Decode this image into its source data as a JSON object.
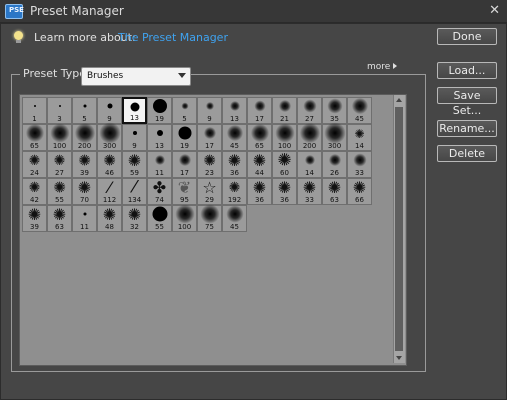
{
  "window": {
    "title": "Preset Manager",
    "close_glyph": "✕",
    "app_icon_text": "PSE"
  },
  "learn": {
    "label": "Learn more about:",
    "link": "The Preset Manager"
  },
  "buttons": {
    "done": "Done",
    "load": "Load...",
    "save_set": "Save Set...",
    "rename": "Rename...",
    "delete": "Delete"
  },
  "preset_type": {
    "label": "Preset Type:",
    "value": "Brushes"
  },
  "more": "more",
  "colors": {
    "background": "#464646",
    "link": "#3fa3f0",
    "grid": "#8f8f8f",
    "cell": "#9b9b9b"
  },
  "brushes": [
    {
      "size": "1",
      "kind": "hard",
      "d": 2
    },
    {
      "size": "3",
      "kind": "hard",
      "d": 2
    },
    {
      "size": "5",
      "kind": "hard",
      "d": 3
    },
    {
      "size": "9",
      "kind": "hard",
      "d": 5
    },
    {
      "size": "13",
      "kind": "hard",
      "d": 9,
      "selected": true
    },
    {
      "size": "19",
      "kind": "hard",
      "d": 14
    },
    {
      "size": "5",
      "kind": "soft",
      "d": 3
    },
    {
      "size": "9",
      "kind": "soft",
      "d": 4
    },
    {
      "size": "13",
      "kind": "soft",
      "d": 6
    },
    {
      "size": "17",
      "kind": "soft",
      "d": 7
    },
    {
      "size": "21",
      "kind": "soft",
      "d": 8
    },
    {
      "size": "27",
      "kind": "soft",
      "d": 9
    },
    {
      "size": "35",
      "kind": "soft",
      "d": 11
    },
    {
      "size": "45",
      "kind": "soft",
      "d": 12
    },
    {
      "size": "65",
      "kind": "soft",
      "d": 14
    },
    {
      "size": "100",
      "kind": "soft",
      "d": 15
    },
    {
      "size": "200",
      "kind": "soft",
      "d": 16
    },
    {
      "size": "300",
      "kind": "soft",
      "d": 17
    },
    {
      "size": "9",
      "kind": "hard",
      "d": 4
    },
    {
      "size": "13",
      "kind": "hard",
      "d": 6
    },
    {
      "size": "19",
      "kind": "hard",
      "d": 13
    },
    {
      "size": "17",
      "kind": "soft",
      "d": 8
    },
    {
      "size": "45",
      "kind": "soft",
      "d": 12
    },
    {
      "size": "65",
      "kind": "soft",
      "d": 14
    },
    {
      "size": "100",
      "kind": "soft",
      "d": 15
    },
    {
      "size": "200",
      "kind": "soft",
      "d": 16
    },
    {
      "size": "300",
      "kind": "soft",
      "d": 17
    },
    {
      "size": "14",
      "kind": "tex",
      "d": 10
    },
    {
      "size": "24",
      "kind": "tex",
      "d": 12
    },
    {
      "size": "27",
      "kind": "tex",
      "d": 12
    },
    {
      "size": "39",
      "kind": "tex",
      "d": 13
    },
    {
      "size": "46",
      "kind": "tex",
      "d": 13
    },
    {
      "size": "59",
      "kind": "tex",
      "d": 14
    },
    {
      "size": "11",
      "kind": "soft",
      "d": 6
    },
    {
      "size": "17",
      "kind": "soft",
      "d": 8
    },
    {
      "size": "23",
      "kind": "tex",
      "d": 13
    },
    {
      "size": "36",
      "kind": "tex",
      "d": 14
    },
    {
      "size": "44",
      "kind": "tex",
      "d": 14
    },
    {
      "size": "60",
      "kind": "tex",
      "d": 15
    },
    {
      "size": "14",
      "kind": "soft",
      "d": 6
    },
    {
      "size": "26",
      "kind": "soft",
      "d": 8
    },
    {
      "size": "33",
      "kind": "soft",
      "d": 9
    },
    {
      "size": "42",
      "kind": "tex",
      "d": 12
    },
    {
      "size": "55",
      "kind": "tex",
      "d": 13
    },
    {
      "size": "70",
      "kind": "tex",
      "d": 14
    },
    {
      "size": "112",
      "kind": "stroke",
      "d": 14
    },
    {
      "size": "134",
      "kind": "stroke",
      "d": 15
    },
    {
      "size": "74",
      "kind": "leaf",
      "d": 14
    },
    {
      "size": "95",
      "kind": "leafl",
      "d": 14
    },
    {
      "size": "29",
      "kind": "star",
      "d": 14
    },
    {
      "size": "192",
      "kind": "tex",
      "d": 12
    },
    {
      "size": "36",
      "kind": "tex",
      "d": 14
    },
    {
      "size": "36",
      "kind": "tex",
      "d": 14
    },
    {
      "size": "33",
      "kind": "tex",
      "d": 14
    },
    {
      "size": "63",
      "kind": "tex",
      "d": 14
    },
    {
      "size": "66",
      "kind": "tex",
      "d": 14
    },
    {
      "size": "39",
      "kind": "tex",
      "d": 14
    },
    {
      "size": "63",
      "kind": "tex",
      "d": 14
    },
    {
      "size": "11",
      "kind": "hard",
      "d": 3
    },
    {
      "size": "48",
      "kind": "tex",
      "d": 14
    },
    {
      "size": "32",
      "kind": "tex",
      "d": 14
    },
    {
      "size": "55",
      "kind": "hard",
      "d": 15
    },
    {
      "size": "100",
      "kind": "soft",
      "d": 15
    },
    {
      "size": "75",
      "kind": "soft",
      "d": 15
    },
    {
      "size": "45",
      "kind": "soft",
      "d": 13
    }
  ]
}
